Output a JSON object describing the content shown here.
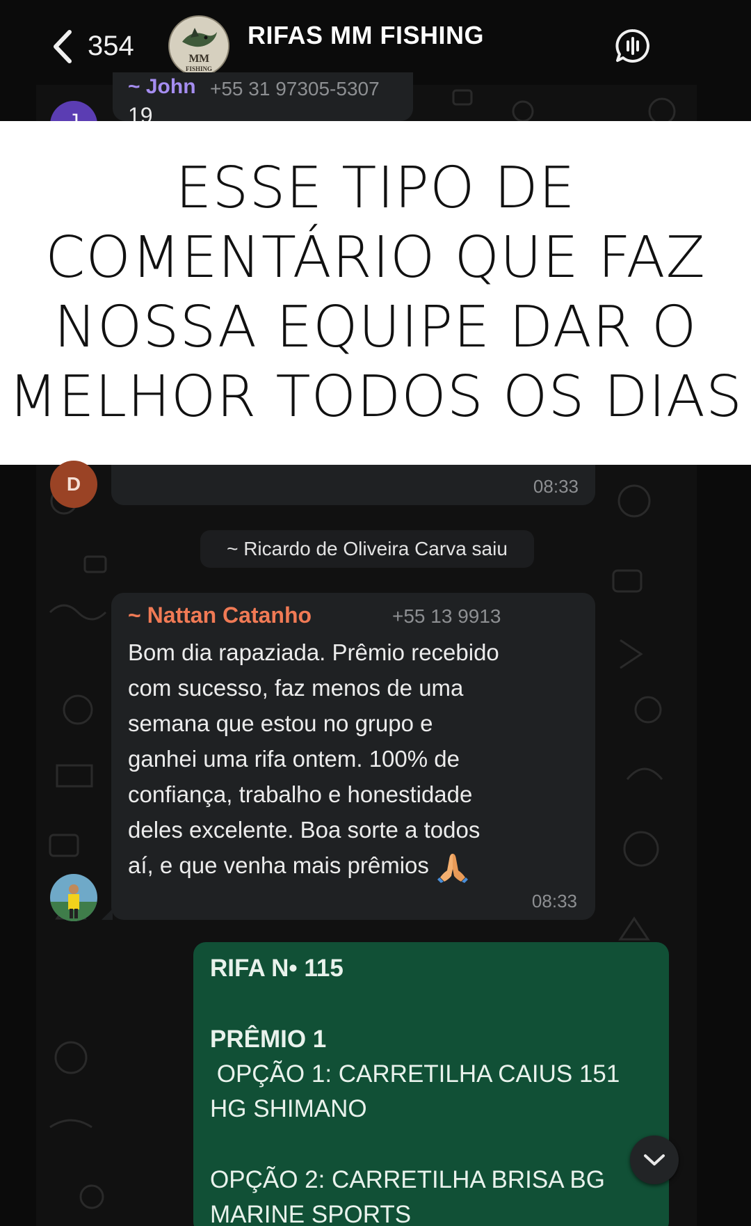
{
  "header": {
    "back_count": "354",
    "group_name": "RIFAS MM FISHING",
    "avatar_logo_text": "MM",
    "avatar_logo_sub": "FISHING"
  },
  "top_message": {
    "sender": "~ John",
    "phone": "+55 31 97305-5307",
    "text": "19",
    "avatar_initial": "J"
  },
  "banner": {
    "lines": [
      "ESSE TIPO DE",
      "COMENTÁRIO QUE FAZ",
      "NOSSA EQUIPE DAR O",
      "MELHOR TODOS OS DIAS"
    ]
  },
  "message_d": {
    "avatar_initial": "D",
    "time": "08:33"
  },
  "system_notice": "~ Ricardo de Oliveira Carva saiu",
  "message_nattan": {
    "sender": "~ Nattan Catanho",
    "phone": "+55 13 9913",
    "lines": [
      "Bom dia rapaziada. Prêmio recebido",
      "com sucesso, faz menos de uma",
      "semana que estou no grupo e",
      "ganhei uma rifa ontem. 100% de",
      "confiança, trabalho e honestidade",
      "deles excelente. Boa sorte a todos",
      "aí, e que venha mais prêmios"
    ],
    "emoji": "folded-hands-icon",
    "time": "08:33"
  },
  "message_rifa": {
    "lines": [
      "RIFA N• 115",
      "",
      "PRÊMIO 1",
      " OPÇÃO 1: CARRETILHA CAIUS 151",
      "HG SHIMANO",
      "",
      "OPÇÃO 2: CARRETILHA BRISA BG",
      "MARINE SPORTS"
    ]
  },
  "colors": {
    "bubble_incoming": "#1f2123",
    "bubble_outgoing": "#115036",
    "sender_nattan": "#f07a55",
    "sender_john": "#a58df0"
  }
}
